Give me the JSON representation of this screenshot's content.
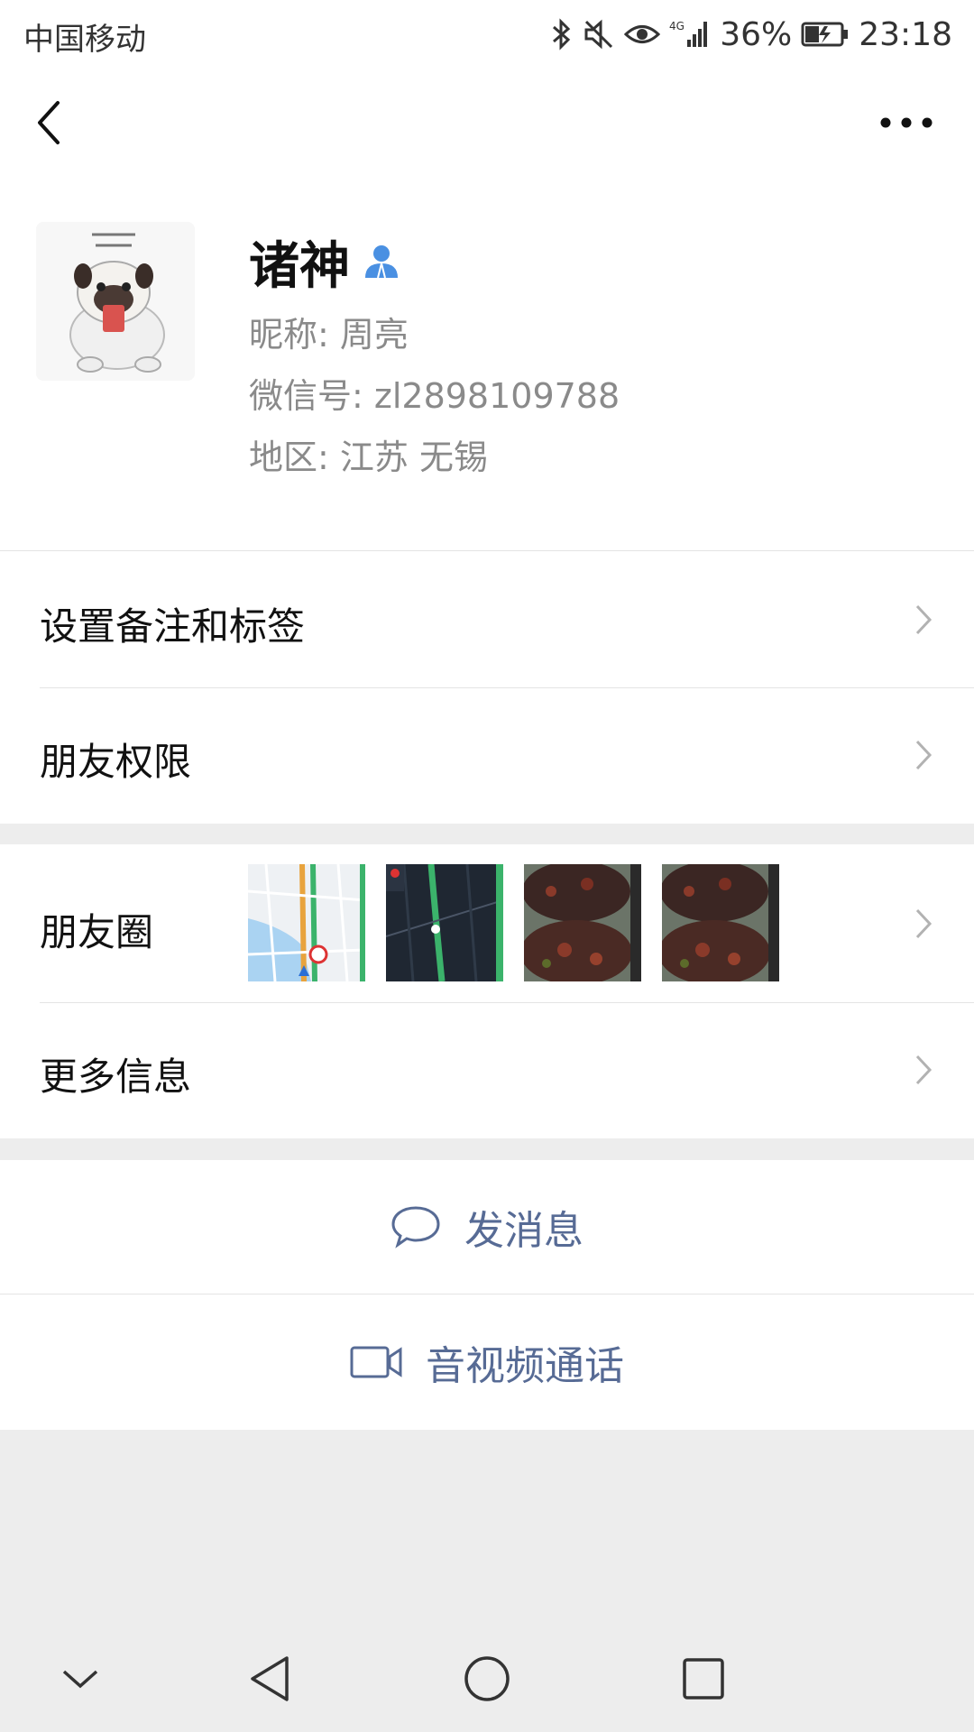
{
  "status_bar": {
    "carrier": "中国移动",
    "network": "4G",
    "battery": "36%",
    "time": "23:18",
    "icons": [
      "bluetooth-icon",
      "mute-icon",
      "eye-icon",
      "signal-icon",
      "battery-charging-icon"
    ]
  },
  "nav": {
    "back_icon": "chevron-left-icon",
    "more_icon": "more-dots-icon"
  },
  "profile": {
    "name": "诸神",
    "contact_badge_icon": "person-icon",
    "nickname": "昵称: 周亮",
    "wechat_id": "微信号: zl2898109788",
    "region": "地区: 江苏  无锡"
  },
  "menu": {
    "remark_tags": "设置备注和标签",
    "friend_permissions": "朋友权限",
    "moments": "朋友圈",
    "more_info": "更多信息"
  },
  "moments_thumbnails": [
    "map-thumbnail",
    "night-map-thumbnail",
    "crayfish-photo",
    "crayfish-photo"
  ],
  "actions": {
    "send_message": "发消息",
    "video_call": "音视频通话"
  },
  "colors": {
    "link_blue": "#576b95",
    "badge_blue": "#4a90e2",
    "background_gray": "#ededed"
  }
}
